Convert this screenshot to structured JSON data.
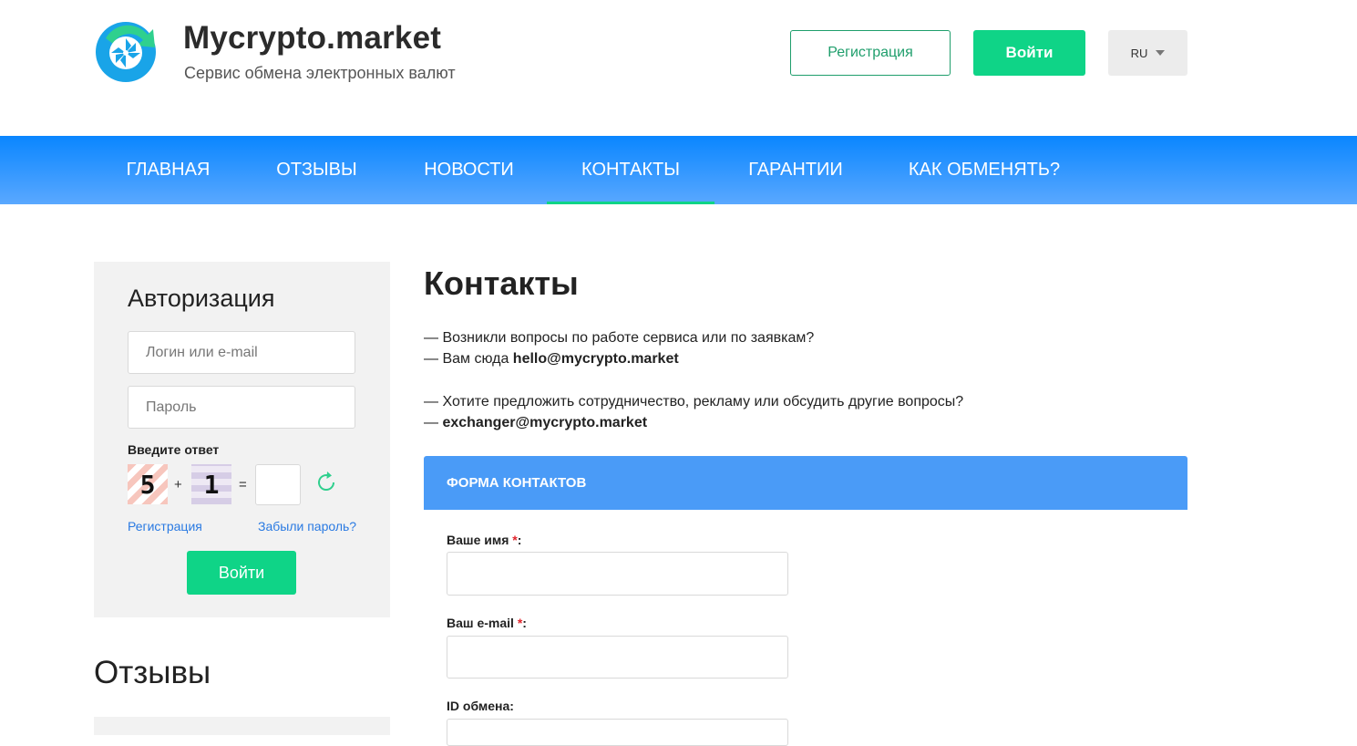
{
  "header": {
    "brand": "Mycrypto.market",
    "tagline": "Сервис обмена электронных валют",
    "register_label": "Регистрация",
    "login_label": "Войти",
    "language": "RU"
  },
  "nav": {
    "items": [
      {
        "label": "ГЛАВНАЯ"
      },
      {
        "label": "ОТЗЫВЫ"
      },
      {
        "label": "НОВОСТИ"
      },
      {
        "label": "КОНТАКТЫ",
        "active": true
      },
      {
        "label": "ГАРАНТИИ"
      },
      {
        "label": "КАК ОБМЕНЯТЬ?"
      }
    ]
  },
  "sidebar": {
    "auth_title": "Авторизация",
    "login_placeholder": "Логин или e-mail",
    "password_placeholder": "Пароль",
    "captcha_label": "Введите ответ",
    "captcha_a": "5",
    "captcha_plus": "+",
    "captcha_b": "1",
    "captcha_eq": "=",
    "register_link": "Регистрация",
    "forgot_link": "Забыли пароль?",
    "login_button": "Войти",
    "reviews_title": "Отзывы"
  },
  "main": {
    "title": "Контакты",
    "line1": "— Возникли вопросы по работе сервиса или по заявкам?",
    "line2_prefix": "— Вам сюда ",
    "line2_email": "hello@mycrypto.market",
    "line3": "— Хотите предложить сотрудничество, рекламу или обсудить другие вопросы?",
    "line4_prefix": "— ",
    "line4_email": "exchanger@mycrypto.market",
    "form_title": "ФОРМА КОНТАКТОВ",
    "name_label": "Ваше имя ",
    "email_label": "Ваш e-mail ",
    "required_mark": "*",
    "colon": ":",
    "exchange_id_label": "ID обмена:"
  },
  "colors": {
    "accent_green": "#0fd487",
    "nav_blue": "#0a86ff",
    "form_header_blue": "#4a9bf7",
    "link_blue": "#2a7ae2"
  }
}
